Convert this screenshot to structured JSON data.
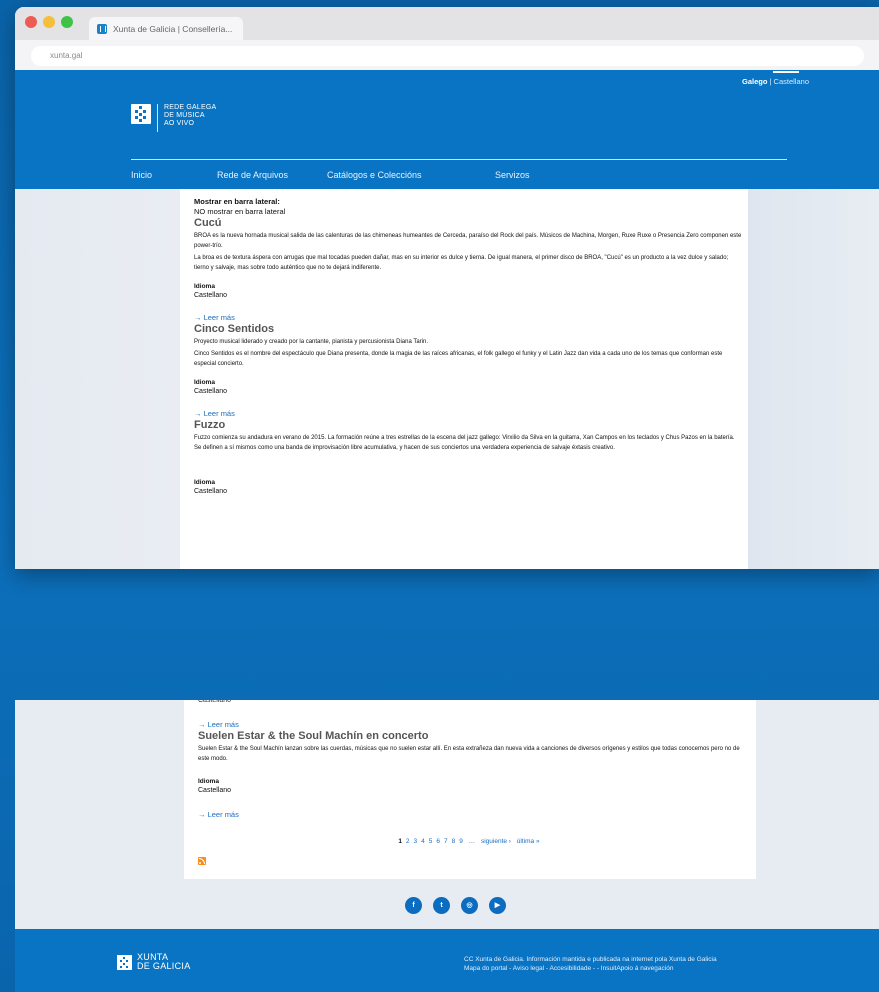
{
  "browser": {
    "tab_title": "Xunta de Galicia | Consellería...",
    "url": "xunta.gal",
    "dot_colors": [
      "#ee5b54",
      "#f5be3b",
      "#3ec347"
    ]
  },
  "header": {
    "lang_active": "Galego",
    "lang_sep": " | ",
    "lang_other": "Castellano",
    "logo_lines": [
      "REDE GALEGA",
      "DE MÚSICA",
      "AO VIVO"
    ],
    "nav": [
      "Inicio",
      "Rede de Arquivos",
      "Catálogos e Coleccións",
      "Servizos"
    ]
  },
  "sidebar_meta": {
    "label": "Mostrar en barra lateral:",
    "value": "NO mostrar en barra lateral"
  },
  "articles_top": [
    {
      "title": "Cucú",
      "paragraphs": [
        "BROA es la nueva hornada musical salida de las calenturas de las chimeneas humeantes de Cerceda, paraíso del Rock del país. Músicos de Machina, Morgen, Ruxe Ruxe o Presencia Zero componen este power-trío.",
        "La broa es de textura áspera con arrugas que mal tocadas pueden dañar, mas en su interior es dulce y tierna. De igual manera, el primer disco de BROA, \"Cucú\" es un producto a la vez dulce y salado; tierno y salvaje, mas sobre todo auténtico que no te dejará indiferente."
      ],
      "idioma_label": "Idioma",
      "idioma_value": "Castellano",
      "more": "Leer más"
    },
    {
      "title": "Cinco Sentidos",
      "paragraphs": [
        "Proyecto musical liderado y creado por la cantante, pianista y percusionista Diana Tarin.",
        "Cinco Sentidos es el nombre del espectáculo que Diana presenta, donde la magia de las raíces africanas, el folk gallego el funky y el Latin Jazz dan vida a cada uno de los temas que conforman este especial concierto."
      ],
      "idioma_label": "Idioma",
      "idioma_value": "Castellano",
      "more": "Leer más"
    },
    {
      "title": "Fuzzo",
      "paragraphs": [
        "Fuzzo comienza su andadura en verano de 2015. La formación reúne a tres estrellas de la escena del jazz gallego: Virxilio da Silva en la guitarra, Xan Campos en los teclados y Chus Pazos en la batería. Se definen a sí mismos como una banda de improvisación libre acumulativa, y hacen de sus conciertos una verdadera experiencia de salvaje éxtasis creativo."
      ],
      "idioma_label": "Idioma",
      "idioma_value": "Castellano"
    }
  ],
  "bottom": {
    "cut_text": "Castellano",
    "more_prev": "Leer más",
    "article": {
      "title": "Suelen Estar & the Soul Machín en concerto",
      "paragraph": "Suelen Estar & the Soul Machín lanzan sobre las cuerdas, músicas que no suelen estar allí. En esta extrañeza dan nueva vida a canciones de diversos orígenes y estilos que todas conocemos pero no de este modo.",
      "idioma_label": "Idioma",
      "idioma_value": "Castellano",
      "more": "Leer más"
    },
    "pager": {
      "current": "1",
      "pages": [
        "2",
        "3",
        "4",
        "5",
        "6",
        "7",
        "8",
        "9"
      ],
      "ellipsis": "…",
      "next": "siguiente ›",
      "last": "última »"
    },
    "socials": [
      "f",
      "t",
      "◎",
      "▶"
    ]
  },
  "footer": {
    "logo_lines": [
      "XUNTA",
      "DE GALICIA"
    ],
    "legal_1": "CC Xunta de Galicia. Información mantida e publicada na internet pola Xunta de Galicia",
    "legal_2": "Mapa do portal - Aviso legal - Accesibilidade -  - InsuitApoio á navegación"
  },
  "colors": {
    "brand_blue": "#0a74c4",
    "link_blue": "#1a6ec0",
    "rss_orange": "#f58e1e"
  }
}
